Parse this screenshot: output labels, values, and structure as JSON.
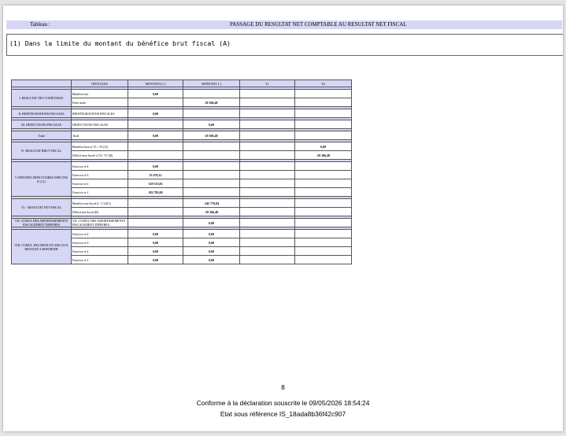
{
  "header": {
    "label": "Tableau :",
    "title": "PASSAGE DU RESULTAT NET COMPTABLE AU RESULTAT NET FISCAL"
  },
  "note": "(1) Dans la limite du montant du bénéfice brut fiscal (A)",
  "table": {
    "columns": [
      "",
      "INTITULES",
      "MONTANT (+)",
      "MONTANT (-)",
      "T1",
      "T2"
    ],
    "sections": [
      {
        "label": "I. RESULTAT NET COMPTABLE",
        "rows": [
          {
            "label": "Bénéfice net",
            "plus": "0,00",
            "minus": "",
            "t1": "",
            "t2": ""
          },
          {
            "label": "Perte nette",
            "plus": "",
            "minus": "29 306,48",
            "t1": "",
            "t2": ""
          }
        ]
      },
      {
        "label": "II. REINTEGRATIONS FISCALES",
        "rows": [
          {
            "label": "REINTEGRATIONS FISCALES",
            "plus": "0,00",
            "minus": "",
            "t1": "",
            "t2": ""
          }
        ]
      },
      {
        "label": "III. DEDUCTIONS FISCALES",
        "rows": [
          {
            "label": "DEDUCTIONS FISCALES",
            "plus": "",
            "minus": "0,00",
            "t1": "",
            "t2": ""
          }
        ]
      },
      {
        "label": "Total",
        "rows": [
          {
            "label": "Total",
            "plus": "0,00",
            "minus": "29 306,48",
            "t1": "",
            "t2": ""
          }
        ]
      },
      {
        "label": "IV. RESULTAT BRUT FISCAL",
        "rows": [
          {
            "label": "Bénéfice brut si T1> T2 (A)",
            "plus": "",
            "minus": "",
            "t1": "",
            "t2": "0,00"
          },
          {
            "label": "Déficit brut fiscal si T2> T1 (B)",
            "plus": "",
            "minus": "",
            "t1": "",
            "t2": "-29 306,48"
          }
        ]
      },
      {
        "label": "V. REPORTS DEFICITAIRES IMPUTES (C) (1)",
        "rows": [
          {
            "label": "Exercice n-4",
            "plus": "0,00",
            "minus": "",
            "t1": "",
            "t2": ""
          },
          {
            "label": "Exercice n-3",
            "plus": "33 470,12",
            "minus": "",
            "t1": "",
            "t2": ""
          },
          {
            "label": "Exercice n-2",
            "plus": "129 513,03",
            "minus": "",
            "t1": "",
            "t2": ""
          },
          {
            "label": "Exercice n-1",
            "plus": "182 783,69",
            "minus": "",
            "t1": "",
            "t2": ""
          }
        ]
      },
      {
        "label": "VI. - RESULTAT NET FISCAL",
        "rows": [
          {
            "label": "Bénéfice net fiscal A - C) (E1)",
            "plus": "",
            "minus": "-345 776,84",
            "t1": "",
            "t2": ""
          },
          {
            "label": "Déficit net fiscal (B)",
            "plus": "",
            "minus": "-29 306,48",
            "t1": "",
            "t2": ""
          }
        ]
      },
      {
        "label": "VII. CUMUL DES AMORTISSEMENTS FISCALEMENT DIFFERES",
        "rows": [
          {
            "label": "VII. CUMUL DES AMORTISSEMENTS FISCALEMENT DIFFERES",
            "plus": "",
            "minus": "0,00",
            "t1": "",
            "t2": ""
          }
        ]
      },
      {
        "label": "VIII. CUMUL DES DEFICITS FISCAUX RESTANT A REPORTER",
        "rows": [
          {
            "label": "Exercice n-4",
            "plus": "0,00",
            "minus": "0,00",
            "t1": "",
            "t2": ""
          },
          {
            "label": "Exercice n-3",
            "plus": "0,00",
            "minus": "0,00",
            "t1": "",
            "t2": ""
          },
          {
            "label": "Exercice n-2",
            "plus": "0,00",
            "minus": "0,00",
            "t1": "",
            "t2": ""
          },
          {
            "label": "Exercice n-1",
            "plus": "0,00",
            "minus": "0,00",
            "t1": "",
            "t2": ""
          }
        ]
      }
    ]
  },
  "footer": {
    "page_number": "8",
    "line1": "Conforme à la déclaration souscrite le 09/05/2026 18:54:24",
    "line2": "Etat sous référence IS_18ada8b36f42c907"
  }
}
